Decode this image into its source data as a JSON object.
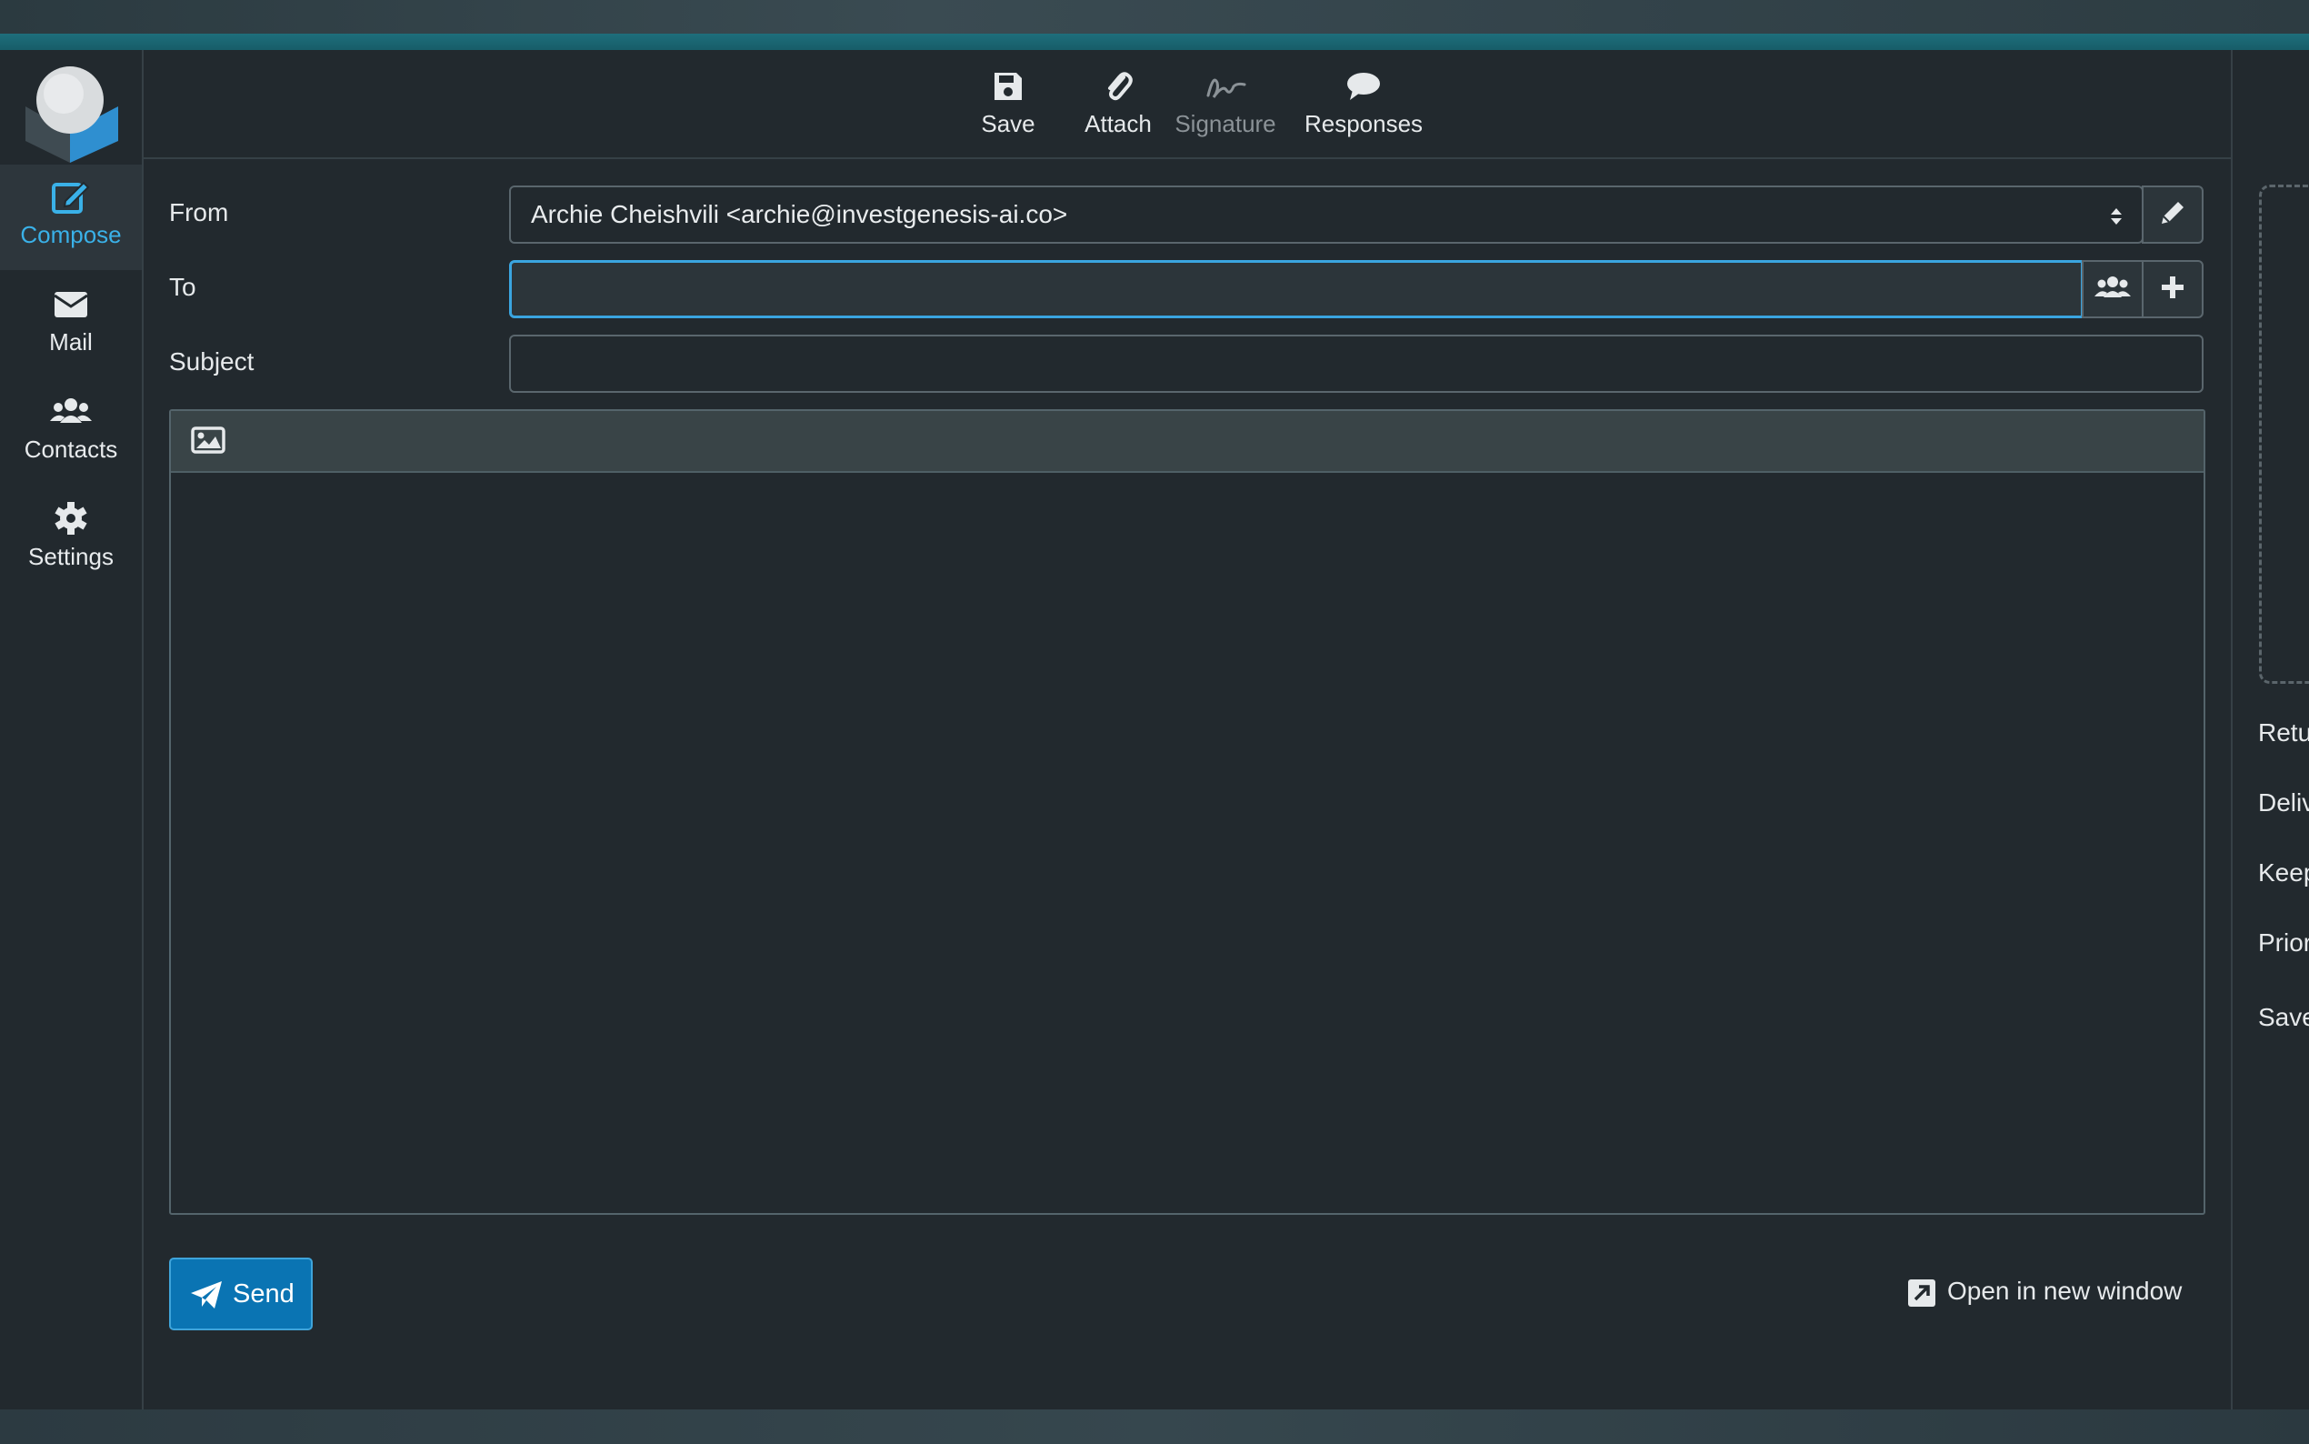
{
  "sidebar": {
    "items": [
      {
        "label": "Compose",
        "icon": "compose-icon",
        "active": true
      },
      {
        "label": "Mail",
        "icon": "mail-icon"
      },
      {
        "label": "Contacts",
        "icon": "contacts-icon"
      },
      {
        "label": "Settings",
        "icon": "gear-icon"
      }
    ]
  },
  "toolbar": {
    "save": "Save",
    "attach": "Attach",
    "signature": "Signature",
    "responses": "Responses"
  },
  "form": {
    "from_label": "From",
    "from_value": "Archie Cheishvili <archie@investgenesis-ai.co>",
    "to_label": "To",
    "to_value": "",
    "subject_label": "Subject",
    "subject_value": ""
  },
  "actions": {
    "send": "Send",
    "open_new_window": "Open in new window"
  },
  "right_panel": {
    "options": [
      "Retu",
      "Deliv",
      "Keep",
      "Prior",
      "Save"
    ]
  },
  "colors": {
    "accent": "#3ab1e8",
    "send_button": "#0a74b3",
    "background": "#22292e"
  }
}
